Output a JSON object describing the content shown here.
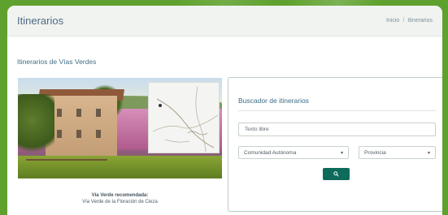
{
  "header": {
    "title": "Itinerarios",
    "breadcrumb": [
      "Inicio",
      "Itinerarios"
    ]
  },
  "section": {
    "title": "Itinerarios de Vías Verdes"
  },
  "featured": {
    "caption_title": "Vía Verde recomendada:",
    "caption_name": "Vía Verde de la Floración de Cieza"
  },
  "search": {
    "title": "Buscador de itinerarios",
    "text_placeholder": "Texto libre",
    "community_selected": "Comunidad Autónoma",
    "province_selected": "Provincia",
    "button_icon": "search-icon"
  },
  "colors": {
    "background": "#5fa12e",
    "accent": "#0e6b5b",
    "title_text": "#4e6a80"
  }
}
